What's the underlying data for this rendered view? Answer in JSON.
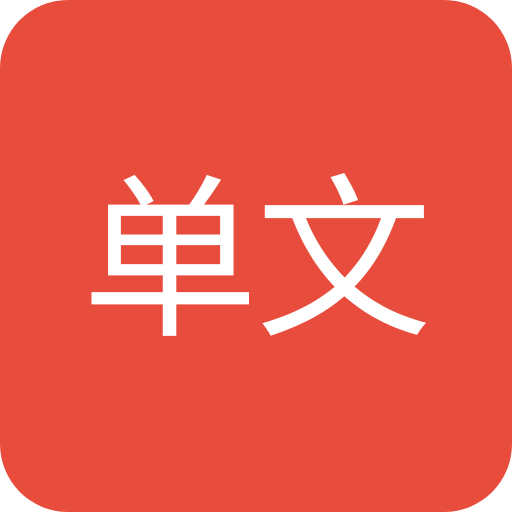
{
  "app_icon": {
    "label": "单文",
    "background_color": "#e74c3c",
    "text_color": "#ffffff"
  }
}
